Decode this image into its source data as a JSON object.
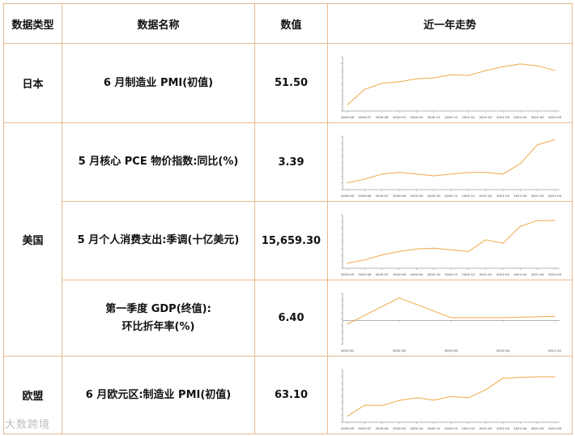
{
  "header": {
    "col_type": "数据类型",
    "col_name": "数据名称",
    "col_value": "数值",
    "col_trend": "近一年走势"
  },
  "rows": [
    {
      "type": "日本",
      "name_line1": "6 月制造业 PMI(初值)",
      "name_line2": "",
      "value": "51.50",
      "chart_data": {
        "type": "line",
        "color": "#f0a84a",
        "x": [
          "2020-06",
          "2020-07",
          "2020-08",
          "2020-09",
          "2020-10",
          "2020-11",
          "2020-12",
          "2021-01",
          "2021-02",
          "2021-03",
          "2021-04",
          "2021-05",
          "2021-06"
        ],
        "values": [
          40.1,
          45.2,
          47.2,
          47.7,
          48.7,
          49.0,
          50.0,
          49.8,
          51.4,
          52.7,
          53.6,
          53.0,
          51.5
        ],
        "ylim": [
          38,
          56
        ],
        "xlabel": "",
        "ylabel": ""
      }
    },
    {
      "type": "美国",
      "name_line1": "5 月核心 PCE 物价指数:同比(%)",
      "name_line2": "",
      "value": "3.39",
      "chart_data": {
        "type": "line",
        "color": "#f0a84a",
        "x": [
          "2020-05",
          "2020-06",
          "2020-07",
          "2020-08",
          "2020-09",
          "2020-10",
          "2020-11",
          "2020-12",
          "2021-01",
          "2021-02",
          "2021-03",
          "2021-04",
          "2021-05"
        ],
        "values": [
          0.9,
          1.1,
          1.4,
          1.5,
          1.4,
          1.3,
          1.4,
          1.5,
          1.5,
          1.4,
          2.0,
          3.1,
          3.39
        ],
        "ylim": [
          0.5,
          3.6
        ],
        "xlabel": "",
        "ylabel": ""
      }
    },
    {
      "type": "",
      "name_line1": "5 月个人消费支出:季调(十亿美元)",
      "name_line2": "",
      "value": "15,659.30",
      "chart_data": {
        "type": "line",
        "color": "#f0a84a",
        "x": [
          "2020-05",
          "2020-06",
          "2020-07",
          "2020-08",
          "2020-09",
          "2020-10",
          "2020-11",
          "2020-12",
          "2021-01",
          "2021-02",
          "2021-03",
          "2021-04",
          "2021-05"
        ],
        "values": [
          13100,
          13300,
          13600,
          13800,
          13950,
          14000,
          13900,
          13800,
          14500,
          14300,
          15300,
          15650,
          15659.3
        ],
        "ylim": [
          12800,
          16000
        ],
        "xlabel": "",
        "ylabel": ""
      }
    },
    {
      "type": "",
      "name_line1": "第一季度 GDP(终值):",
      "name_line2": "环比折年率(%)",
      "value": "6.40",
      "chart_data": {
        "type": "line",
        "color": "#f0a84a",
        "x": [
          "2020-Q1",
          "2020-Q2",
          "2020-Q3",
          "2020-Q4",
          "2021-Q1"
        ],
        "values": [
          -5.1,
          33.4,
          4.3,
          4.3,
          6.4
        ],
        "ylim": [
          -35,
          40
        ],
        "xlabel": "",
        "ylabel": ""
      }
    },
    {
      "type": "欧盟",
      "name_line1": "6 月欧元区:制造业 PMI(初值)",
      "name_line2": "",
      "value": "63.10",
      "chart_data": {
        "type": "line",
        "color": "#f0a84a",
        "x": [
          "2020-06",
          "2020-07",
          "2020-08",
          "2020-09",
          "2020-10",
          "2020-11",
          "2020-12",
          "2021-01",
          "2021-02",
          "2021-03",
          "2021-04",
          "2021-05",
          "2021-06"
        ],
        "values": [
          47.4,
          51.8,
          51.7,
          53.7,
          54.8,
          53.8,
          55.2,
          54.8,
          57.9,
          62.5,
          62.9,
          63.1,
          63.1
        ],
        "ylim": [
          45,
          66
        ],
        "xlabel": "",
        "ylabel": ""
      }
    }
  ],
  "watermark": "大数跨境"
}
